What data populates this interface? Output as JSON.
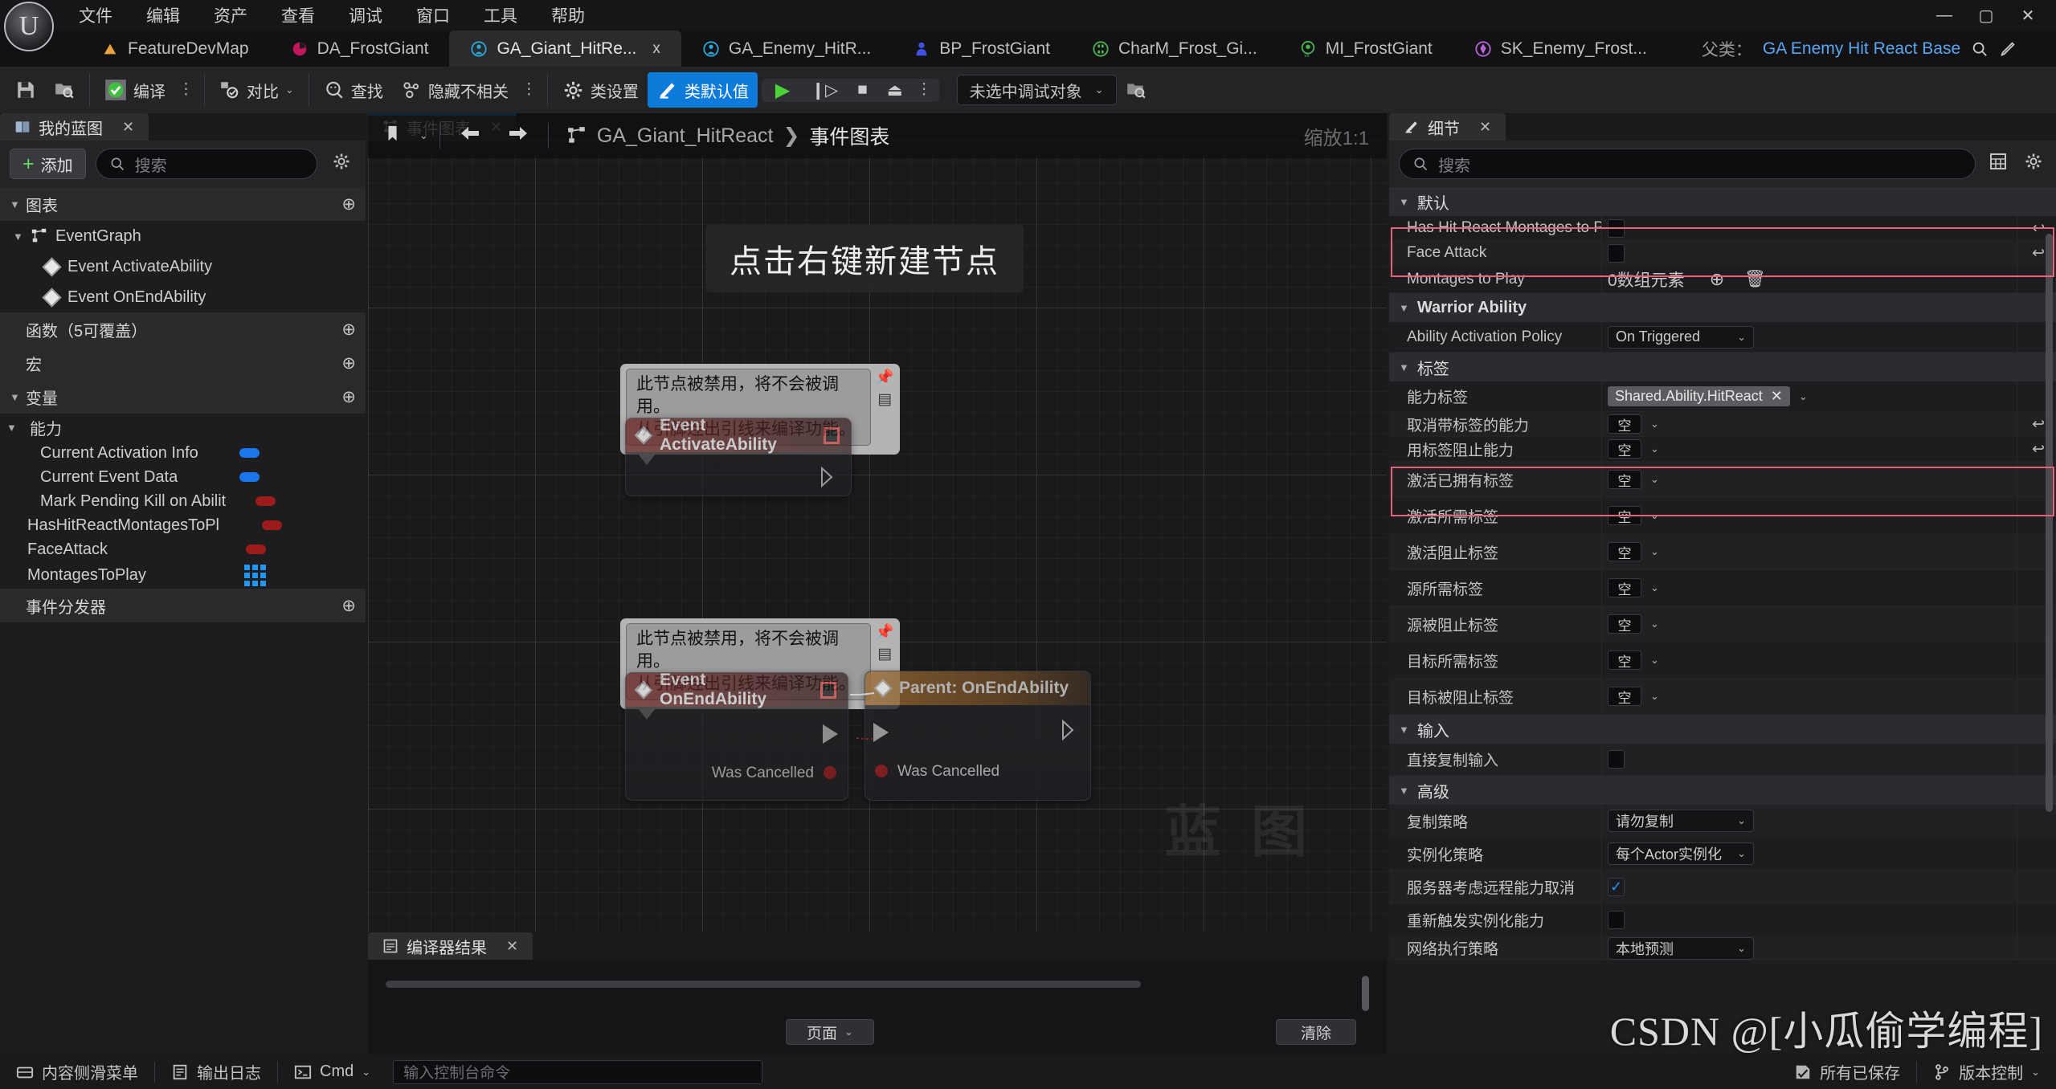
{
  "window": {
    "menu": [
      "文件",
      "编辑",
      "资产",
      "查看",
      "调试",
      "窗口",
      "工具",
      "帮助"
    ],
    "minimize": "—",
    "maximize": "▢",
    "close": "✕"
  },
  "asset_tabs": [
    {
      "label": "FeatureDevMap",
      "icon": "level-icon",
      "color": "#e8a33d",
      "active": false,
      "closable": false
    },
    {
      "label": "DA_FrostGiant",
      "icon": "data-asset-icon",
      "color": "#c2185b",
      "active": false,
      "closable": false
    },
    {
      "label": "GA_Giant_HitRe...",
      "icon": "blueprint-icon",
      "color": "#29a8d8",
      "active": true,
      "closable": true,
      "close": "x"
    },
    {
      "label": "GA_Enemy_HitR...",
      "icon": "blueprint-icon",
      "color": "#29a8d8",
      "active": false,
      "closable": false
    },
    {
      "label": "BP_FrostGiant",
      "icon": "actor-blueprint-icon",
      "color": "#3f51e0",
      "active": false,
      "closable": false
    },
    {
      "label": "CharM_Frost_Gi...",
      "icon": "character-icon",
      "color": "#4caf50",
      "active": false,
      "closable": false
    },
    {
      "label": "MI_FrostGiant",
      "icon": "material-instance-icon",
      "color": "#4caf50",
      "active": false,
      "closable": false
    },
    {
      "label": "SK_Enemy_Frost...",
      "icon": "skeletal-mesh-icon",
      "color": "#b565d8",
      "active": false,
      "closable": false
    }
  ],
  "parent_class": {
    "label": "父类：",
    "value": "GA Enemy Hit React Base",
    "browse_icon": "magnifier-icon",
    "edit_icon": "pencil-icon"
  },
  "toolbar": {
    "save": "save-icon",
    "browse": "browse-content-icon",
    "compile": "编译",
    "compile_icon": "compile-check-icon",
    "diff": "对比",
    "diff_icon": "diff-icon",
    "find": "查找",
    "find_icon": "find-icon",
    "hide_unrelated": "隐藏不相关",
    "hide_unrelated_icon": "hide-unrelated-icon",
    "class_settings": "类设置",
    "class_settings_icon": "gear-icon",
    "class_defaults": "类默认值",
    "class_defaults_icon": "defaults-icon",
    "accent_color": "#0e7bda",
    "play_icon": "play-icon",
    "step_icon": "step-icon",
    "stop_icon": "stop-icon",
    "eject_icon": "eject-icon",
    "dots": "⋮",
    "debug_object": "未选中调试对象",
    "debug_browse_icon": "browse-content-icon"
  },
  "my_blueprint": {
    "tab_title": "我的蓝图",
    "tab_icon": "book-icon",
    "close": "✕",
    "add_label": "添加",
    "search_placeholder": "搜索",
    "search_icon": "search-icon",
    "settings_icon": "gear-icon",
    "sections": [
      {
        "label": "图表",
        "expandable": true,
        "has_add": true
      },
      {
        "label": "函数（5可覆盖）",
        "expandable": false,
        "has_add": true
      },
      {
        "label": "宏",
        "expandable": false,
        "has_add": true
      },
      {
        "label": "变量",
        "expandable": true,
        "has_add": true
      }
    ],
    "graph_tree": {
      "root": "EventGraph",
      "root_icon": "graph-icon",
      "children": [
        {
          "label": "Event ActivateAbility",
          "icon": "event-diamond-icon"
        },
        {
          "label": "Event OnEndAbility",
          "icon": "event-diamond-icon"
        }
      ]
    },
    "variable_category": "能力",
    "variables": [
      {
        "name": "Current Activation Info",
        "type_color": "#1976ed",
        "shape": "pill",
        "indent": 2
      },
      {
        "name": "Current Event Data",
        "type_color": "#1976ed",
        "shape": "pill",
        "indent": 2
      },
      {
        "name": "Mark Pending Kill on Abilit",
        "type_color": "#9c1c1c",
        "shape": "pill",
        "indent": 2
      },
      {
        "name": "HasHitReactMontagesToPl",
        "type_color": "#9c1c1c",
        "shape": "pill",
        "indent": 1
      },
      {
        "name": "FaceAttack",
        "type_color": "#9c1c1c",
        "shape": "pill",
        "indent": 1
      },
      {
        "name": "MontagesToPlay",
        "type_color": "#2196f3",
        "shape": "grid",
        "indent": 1
      }
    ],
    "event_dispatchers": "事件分发器"
  },
  "graph": {
    "tab_title": "事件图表",
    "tab_icon": "graph-icon",
    "close": "✕",
    "nav_back_icon": "arrow-left-icon",
    "nav_fwd_icon": "arrow-right-icon",
    "bookmark_icon": "bookmark-icon",
    "breadcrumb_icon": "graph-icon",
    "breadcrumb_asset": "GA_Giant_HitReact",
    "breadcrumb_sep": "❯",
    "breadcrumb_graph": "事件图表",
    "zoom_label": "缩放1:1",
    "hint": "点击右键新建节点",
    "watermark": "蓝 图",
    "comment_text_line1": "此节点被禁用，将不会被调用。",
    "comment_text_line2": "从引脚连出引线来编译功能。",
    "nodes": [
      {
        "title": "Event ActivateAbility",
        "kind": "event",
        "disabled": true,
        "delegate_pin": true,
        "out_pins": []
      },
      {
        "title": "Event OnEndAbility",
        "kind": "event",
        "disabled": true,
        "delegate_pin": true,
        "out_pins": [
          "Was Cancelled"
        ]
      },
      {
        "title": "Parent: OnEndAbility",
        "kind": "parent",
        "disabled": false,
        "delegate_pin": false,
        "in_pins": [
          "Was Cancelled"
        ]
      }
    ]
  },
  "compiler": {
    "tab_title": "编译器结果",
    "tab_icon": "compiler-icon",
    "close": "✕",
    "page_label": "页面",
    "clear_label": "清除"
  },
  "details": {
    "tab_title": "细节",
    "tab_icon": "details-icon",
    "close": "✕",
    "search_placeholder": "搜索",
    "search_icon": "search-icon",
    "grid_icon": "grid-view-icon",
    "settings_icon": "gear-icon",
    "groups": [
      {
        "name": "默认",
        "bold": false,
        "rows": [
          {
            "label": "Has Hit React Montages to Play",
            "control": "checkbox",
            "checked": false,
            "revert": true,
            "highlight": true
          },
          {
            "label": "Face Attack",
            "control": "checkbox",
            "checked": false,
            "revert": true,
            "highlight": true
          },
          {
            "label": "Montages to Play",
            "control": "array",
            "value": "0数组元素",
            "add_icon": "plus-circle-icon",
            "delete_icon": "trash-icon"
          }
        ]
      },
      {
        "name": "Warrior Ability",
        "bold": true,
        "rows": [
          {
            "label": "Ability Activation Policy",
            "control": "combo",
            "value": "On Triggered"
          }
        ]
      },
      {
        "name": "标签",
        "bold": false,
        "rows": [
          {
            "label": "能力标签",
            "control": "tagchip",
            "value": "Shared.Ability.HitReact",
            "chip_close": "✕"
          },
          {
            "label": "取消带标签的能力",
            "control": "tag",
            "value": "空",
            "revert": true,
            "highlight": true
          },
          {
            "label": "用标签阻止能力",
            "control": "tag",
            "value": "空",
            "revert": true,
            "highlight": true
          },
          {
            "label": "激活已拥有标签",
            "control": "tag",
            "value": "空"
          },
          {
            "label": "激活所需标签",
            "control": "tag",
            "value": "空"
          },
          {
            "label": "激活阻止标签",
            "control": "tag",
            "value": "空"
          },
          {
            "label": "源所需标签",
            "control": "tag",
            "value": "空"
          },
          {
            "label": "源被阻止标签",
            "control": "tag",
            "value": "空"
          },
          {
            "label": "目标所需标签",
            "control": "tag",
            "value": "空"
          },
          {
            "label": "目标被阻止标签",
            "control": "tag",
            "value": "空"
          }
        ]
      },
      {
        "name": "输入",
        "bold": false,
        "rows": [
          {
            "label": "直接复制输入",
            "control": "checkbox",
            "checked": false
          }
        ]
      },
      {
        "name": "高级",
        "bold": false,
        "rows": [
          {
            "label": "复制策略",
            "control": "combo",
            "value": "请勿复制"
          },
          {
            "label": "实例化策略",
            "control": "combo",
            "value": "每个Actor实例化"
          },
          {
            "label": "服务器考虑远程能力取消",
            "control": "checkbox",
            "checked": true
          },
          {
            "label": "重新触发实例化能力",
            "control": "checkbox",
            "checked": false
          },
          {
            "label": "网络执行策略",
            "control": "combo",
            "value": "本地预测"
          }
        ]
      }
    ]
  },
  "statusbar": {
    "content_drawer": "内容侧滑菜单",
    "content_drawer_icon": "drawer-icon",
    "output_log": "输出日志",
    "output_log_icon": "log-icon",
    "cmd_label": "Cmd",
    "cmd_icon": "terminal-icon",
    "cmd_placeholder": "输入控制台命令",
    "all_saved": "所有已保存",
    "all_saved_icon": "save-check-icon",
    "source_control": "版本控制",
    "source_control_icon": "branch-icon"
  },
  "watermark": "CSDN @[小瓜偷学编程]"
}
